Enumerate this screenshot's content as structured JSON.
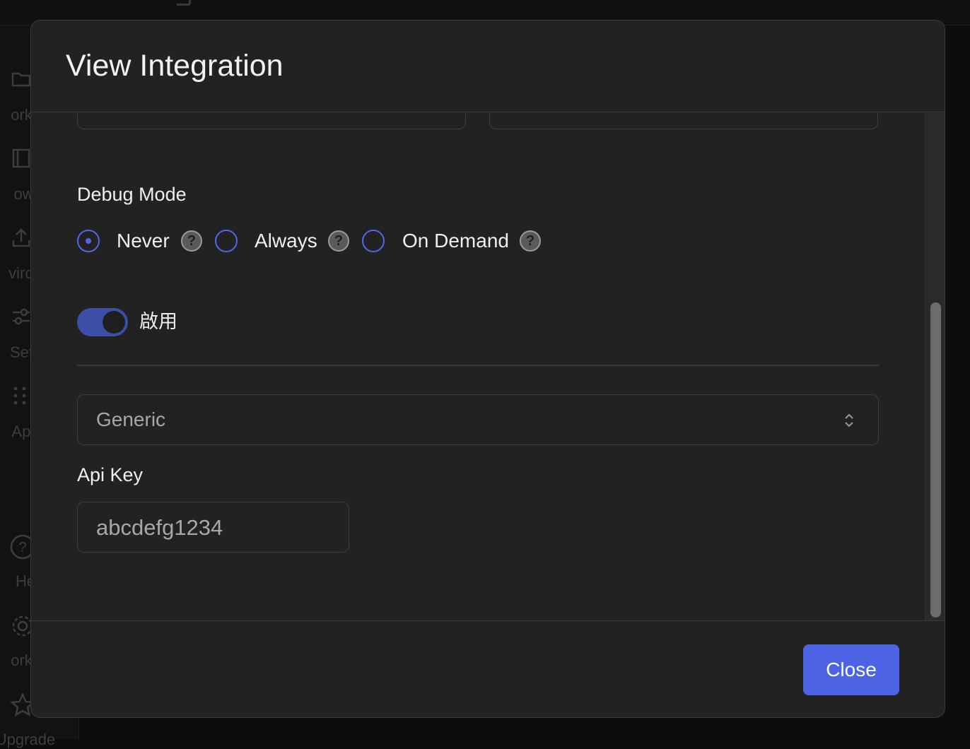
{
  "background": {
    "sidebar": [
      {
        "icon": "folder-icon",
        "label": "orkfl"
      },
      {
        "icon": "book-icon",
        "label": "owl"
      },
      {
        "icon": "upload-icon",
        "label": "viron"
      },
      {
        "icon": "sliders-icon",
        "label": "Setti"
      },
      {
        "icon": "grid-icon",
        "label": "App"
      },
      {
        "icon": "help-circle-icon",
        "label": "He"
      },
      {
        "icon": "gear-icon",
        "label": "orks"
      },
      {
        "icon": "star-icon",
        "label": "Upgrade"
      }
    ]
  },
  "modal": {
    "title": "View Integration",
    "debug_mode": {
      "label": "Debug Mode",
      "options": [
        {
          "label": "Never",
          "checked": true
        },
        {
          "label": "Always",
          "checked": false
        },
        {
          "label": "On Demand",
          "checked": false
        }
      ]
    },
    "enabled_toggle": {
      "label": "啟用",
      "on": true
    },
    "provider_select": {
      "value": "Generic"
    },
    "api_key": {
      "label": "Api Key",
      "value": "abcdefg1234"
    },
    "close_label": "Close"
  },
  "colors": {
    "accent": "#4c63e6",
    "toggle_on": "#3c4ea8",
    "modal_bg": "#222222"
  }
}
